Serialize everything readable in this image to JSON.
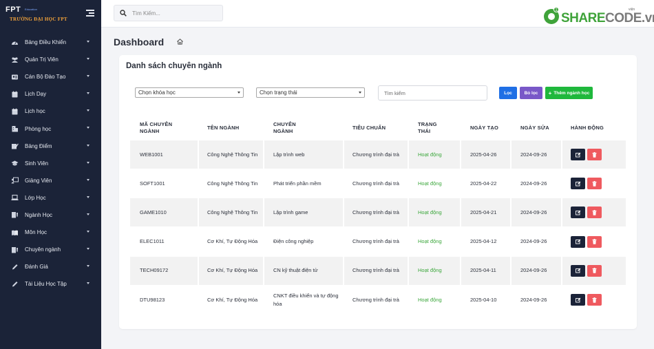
{
  "sidebar": {
    "logo_fpt": "FPT",
    "logo_edu": "Education",
    "logo_name": "TRƯỜNG ĐẠI HỌC FPT",
    "items": [
      {
        "label": "Bảng Điều Khiển",
        "icon": "dashboard-icon"
      },
      {
        "label": "Quản Trị Viên",
        "icon": "users-icon"
      },
      {
        "label": "Cán Bộ Đào Tạo",
        "icon": "staff-icon"
      },
      {
        "label": "Lịch Dạy",
        "icon": "calendar-icon"
      },
      {
        "label": "Lịch học",
        "icon": "calendar-icon"
      },
      {
        "label": "Phòng học",
        "icon": "building-icon"
      },
      {
        "label": "Bảng Điểm",
        "icon": "gradebook-icon"
      },
      {
        "label": "Sinh Viên",
        "icon": "graduation-cap-icon"
      },
      {
        "label": "Giảng Viên",
        "icon": "teacher-icon"
      },
      {
        "label": "Lớp Học",
        "icon": "laptop-icon"
      },
      {
        "label": "Ngành Học",
        "icon": "tie-icon"
      },
      {
        "label": "Môn Học",
        "icon": "book-icon"
      },
      {
        "label": "Chuyên ngành",
        "icon": "tie-icon"
      },
      {
        "label": "Đánh Giá",
        "icon": "pen-icon"
      },
      {
        "label": "Tài Liệu Học Tập",
        "icon": "pen-icon"
      }
    ]
  },
  "topbar": {
    "search_placeholder": "Tìm Kiếm...",
    "brand_share": "SHARE",
    "brand_code": "CODE.vn",
    "brand_badge": "1",
    "brand_vn": "viện"
  },
  "page": {
    "title": "Dashboard"
  },
  "card": {
    "title": "Danh sách chuyên ngành",
    "filters": {
      "course_select": "Chọn khóa học",
      "status_select": "Chọn trạng thái",
      "search_placeholder": "Tìm kiếm",
      "filter_button": "Lọc",
      "reset_button": "Bỏ lọc",
      "add_button": "Thêm ngành học"
    },
    "columns": [
      "MÃ CHUYÊN NGÀNH",
      "TÊN NGÀNH",
      "CHUYÊN NGÀNH",
      "TIÊU CHUẨN",
      "TRẠNG THÁI",
      "NGÀY TẠO",
      "NGÀY SỬA",
      "HÀNH ĐỘNG"
    ],
    "rows": [
      {
        "code": "WEB1001",
        "major": "Công Nghệ Thông Tin",
        "specialty": "Lập trình web",
        "standard": "Chương trình đại trà",
        "status": "Hoạt động",
        "created": "2025-04-26",
        "updated": "2024-09-26"
      },
      {
        "code": "SOFT1001",
        "major": "Công Nghệ Thông Tin",
        "specialty": "Phát triển phần mềm",
        "standard": "Chương trình đại trà",
        "status": "Hoạt động",
        "created": "2025-04-22",
        "updated": "2024-09-26"
      },
      {
        "code": "GAME1010",
        "major": "Công Nghệ Thông Tin",
        "specialty": "Lập trình game",
        "standard": "Chương trình đại trà",
        "status": "Hoạt động",
        "created": "2025-04-21",
        "updated": "2024-09-26"
      },
      {
        "code": "ELEC1011",
        "major": "Cơ Khí, Tự Động Hóa",
        "specialty": "Điện công nghiệp",
        "standard": "Chương trình đại trà",
        "status": "Hoạt động",
        "created": "2025-04-12",
        "updated": "2024-09-26"
      },
      {
        "code": "TECH09172",
        "major": "Cơ Khí, Tự Động Hóa",
        "specialty": "CN kỹ thuật điện tử",
        "standard": "Chương trình đại trà",
        "status": "Hoạt động",
        "created": "2025-04-11",
        "updated": "2024-09-26"
      },
      {
        "code": "DTU98123",
        "major": "Cơ Khí, Tự Động Hóa",
        "specialty": "CNKT điều khiển và tự động hóa",
        "standard": "Chương trình đại trà",
        "status": "Hoạt động",
        "created": "2025-04-10",
        "updated": "2024-09-26"
      }
    ]
  },
  "colors": {
    "sidebar_bg": "#1b2338",
    "status_active": "#3aa63a",
    "btn_filter": "#1f6fe5",
    "btn_reset": "#7958c8",
    "btn_add": "#1fb83c",
    "btn_edit": "#1b2338",
    "btn_delete": "#ef5a5f"
  }
}
